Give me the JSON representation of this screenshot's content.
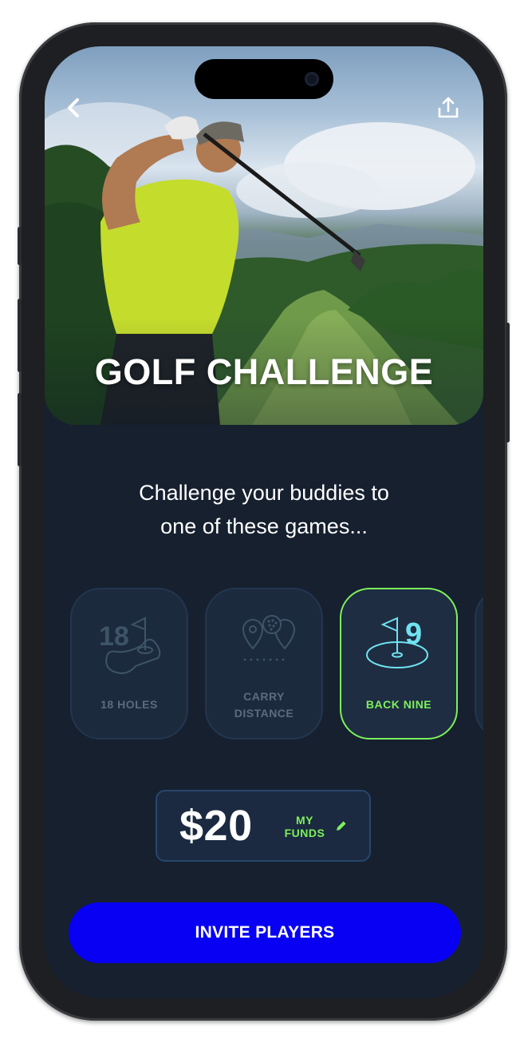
{
  "hero": {
    "title": "GOLF CHALLENGE",
    "back_icon": "chevron-left-icon",
    "share_icon": "share-icon"
  },
  "subtitle": {
    "line1": "Challenge your buddies to",
    "line2": "one of these games..."
  },
  "games": [
    {
      "label": "18 HOLES",
      "icon": "18-holes-icon",
      "art_text": "18",
      "selected": false
    },
    {
      "label_line1": "CARRY",
      "label_line2": "DISTANCE",
      "icon": "carry-distance-icon",
      "selected": false
    },
    {
      "label": "BACK NINE",
      "icon": "back-nine-icon",
      "art_text": "9",
      "selected": true
    }
  ],
  "funds": {
    "amount": "$20",
    "label_line1": "MY",
    "label_line2": "FUNDS",
    "edit_icon": "pencil-icon"
  },
  "cta": {
    "label": "INVITE PLAYERS"
  },
  "colors": {
    "background": "#16202f",
    "card": "#1c2a3d",
    "accent_green": "#7cf15a",
    "accent_cyan": "#6fe3f0",
    "cta_blue": "#0800f2",
    "muted": "#5c6b7d"
  }
}
